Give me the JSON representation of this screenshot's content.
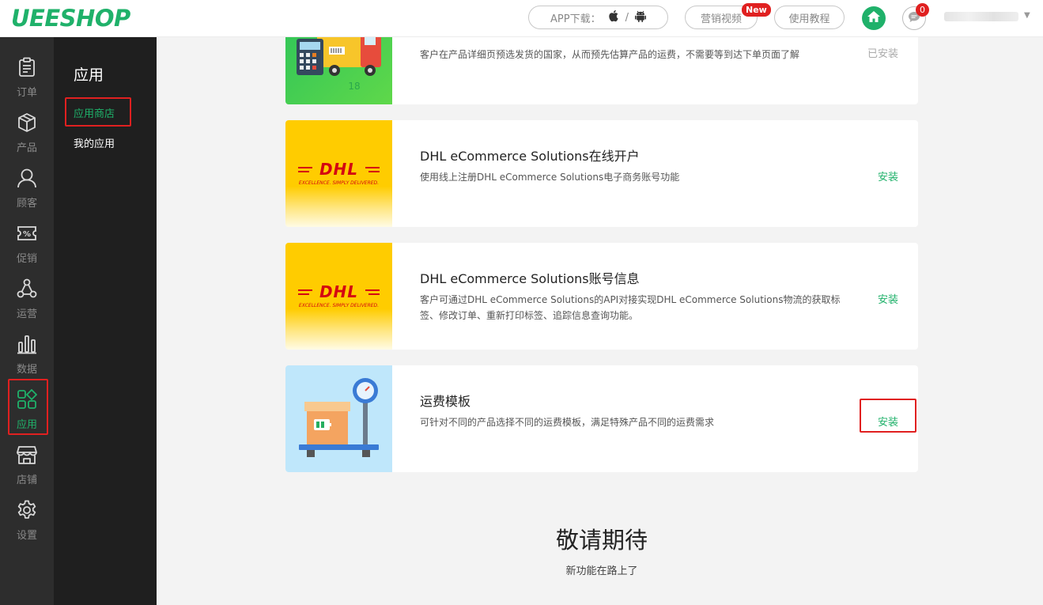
{
  "header": {
    "logo": "UEESHOP",
    "app_download_label": "APP下载：",
    "app_separator": "/",
    "marketing_video": "营销视频",
    "new_badge": "New",
    "tutorial": "使用教程",
    "message_count": "0"
  },
  "leftnav": {
    "items": [
      {
        "label": "订单",
        "icon": "clipboard-icon"
      },
      {
        "label": "产品",
        "icon": "box-icon"
      },
      {
        "label": "顾客",
        "icon": "user-icon"
      },
      {
        "label": "促销",
        "icon": "coupon-icon"
      },
      {
        "label": "运营",
        "icon": "network-icon"
      },
      {
        "label": "数据",
        "icon": "bar-chart-icon"
      },
      {
        "label": "应用",
        "icon": "apps-icon"
      },
      {
        "label": "店铺",
        "icon": "store-icon"
      },
      {
        "label": "设置",
        "icon": "gear-icon"
      }
    ],
    "active": "应用"
  },
  "submenu": {
    "title": "应用",
    "items": [
      {
        "label": "应用商店"
      },
      {
        "label": "我的应用"
      }
    ]
  },
  "apps": [
    {
      "title": "",
      "desc": "客户在产品详细页预选发货的国家，从而预先估算产品的运费，不需要等到达下单页面了解",
      "action": "已安装",
      "image_text": "18"
    },
    {
      "title": "DHL eCommerce Solutions在线开户",
      "desc": "使用线上注册DHL eCommerce Solutions电子商务账号功能",
      "action": "安装",
      "logo_word": "DHL",
      "logo_tagline": "EXCELLENCE. SIMPLY DELIVERED."
    },
    {
      "title": "DHL eCommerce Solutions账号信息",
      "desc": "客户可通过DHL eCommerce Solutions的API对接实现DHL eCommerce Solutions物流的获取标签、修改订单、重新打印标签、追踪信息查询功能。",
      "action": "安装",
      "logo_word": "DHL",
      "logo_tagline": "EXCELLENCE. SIMPLY DELIVERED."
    },
    {
      "title": "运费模板",
      "desc": "可针对不同的产品选择不同的运费模板，满足特殊产品不同的运费需求",
      "action": "安装"
    }
  ],
  "coming_soon": {
    "title": "敬请期待",
    "subtitle": "新功能在路上了"
  },
  "colors": {
    "brand_green": "#1fb16a",
    "highlight_red": "#e02020",
    "dhl_yellow": "#ffcc00",
    "dhl_red": "#d40511"
  }
}
